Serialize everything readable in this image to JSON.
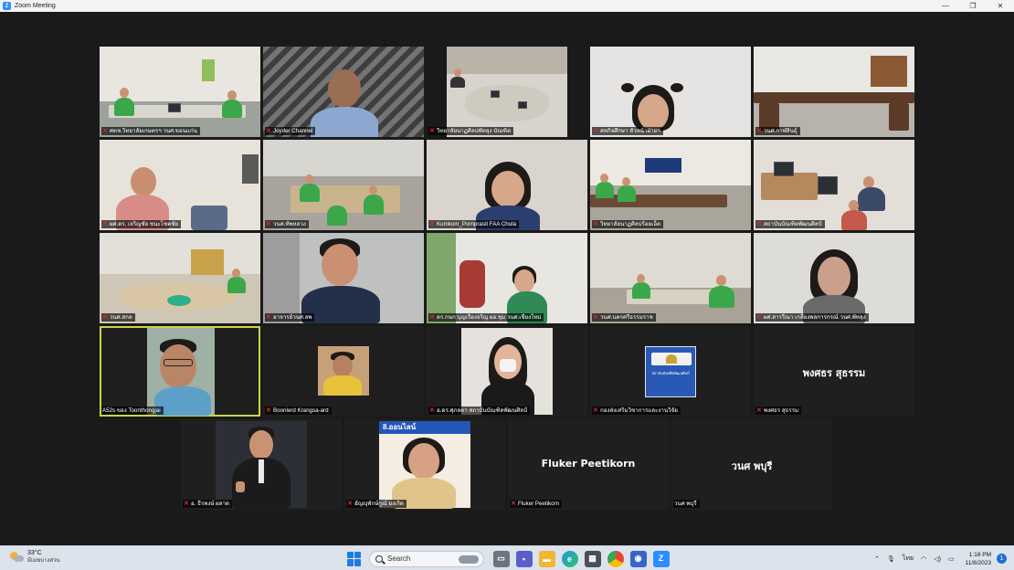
{
  "window": {
    "title": "Zoom Meeting",
    "app_icon": "Z",
    "controls": [
      "—",
      "❐",
      "✕"
    ]
  },
  "participants": [
    {
      "name": "ศตช.วิทยาลัยเกษตรฯ วนศ.ขอนแก่น",
      "muted": true
    },
    {
      "name": "Joyder Channel",
      "muted": true
    },
    {
      "name": "วิทยาลัยนาฏศิลปพัทลุง บัณฑิต",
      "muted": true
    },
    {
      "name": "สหกิจศึกษา หัวหน้าฝ่ายฯ",
      "muted": true
    },
    {
      "name": "วนศ.กาฬสินธุ์",
      "muted": true
    },
    {
      "name": "ผศ.ดร. เจริญชัย ชนะโชคชัย",
      "muted": true
    },
    {
      "name": "วนศ.ทัพหลวง",
      "muted": true
    },
    {
      "name": "Kumkom_Pornprasit FAA Chula",
      "muted": true
    },
    {
      "name": "วิทยาลัยนาฏศิลปร้อยเอ็ด",
      "muted": true
    },
    {
      "name": "สถาบันบัณฑิตพัฒนศิลป์",
      "muted": true
    },
    {
      "name": "วนศ.สกล",
      "muted": true
    },
    {
      "name": "อาจารย์วนศ.ลพ",
      "muted": true
    },
    {
      "name": "ดร.กนก บุญเรืองจริญ ผอ.ชุม วนศ.เชียงใหม่",
      "muted": true
    },
    {
      "name": "วนศ.นครศรีธรรมราช",
      "muted": true
    },
    {
      "name": "ผศ.สารรีณา เกลี้ยงพลการกรณ์ วนศ.พัทลุง",
      "muted": true
    },
    {
      "name": "A52s ของ Toonthongjai",
      "muted": false
    },
    {
      "name": "Boonlerd Krangsa-ard",
      "muted": true
    },
    {
      "name": "อ.ดร.ศุภลดา สถาบันบัณฑิตพัฒนศิลป์",
      "muted": true
    },
    {
      "name": "กองส่งเสริมวิชาการและงานวิจัย",
      "muted": true
    },
    {
      "name": "พงศธร สุธรรม",
      "muted": true,
      "display_name": "พงศธร สุธรรม"
    },
    {
      "name": "อ. ธีรพงษ์ ผลาด",
      "muted": true
    },
    {
      "name": "อัญญุพักษ์กูณ์ ยงเกิด",
      "muted": true
    },
    {
      "name": "Fluker Peetikorn",
      "muted": true,
      "display_name": "Fluker Peetikorn"
    },
    {
      "name": "วนศ พบุรี",
      "muted": false,
      "display_name": "วนศ พบุรี"
    }
  ],
  "shared_slide_text": "8.ออนไลน์",
  "logo_text": "สถาบันบัณฑิตพัฒนศิลป์",
  "taskbar": {
    "weather_temp": "33°C",
    "weather_cond": "มีเมฆบางส่วน",
    "search_label": "Search",
    "lang": "ไทย",
    "time": "1:18 PM",
    "date": "11/8/2023",
    "notif_count": "1"
  }
}
